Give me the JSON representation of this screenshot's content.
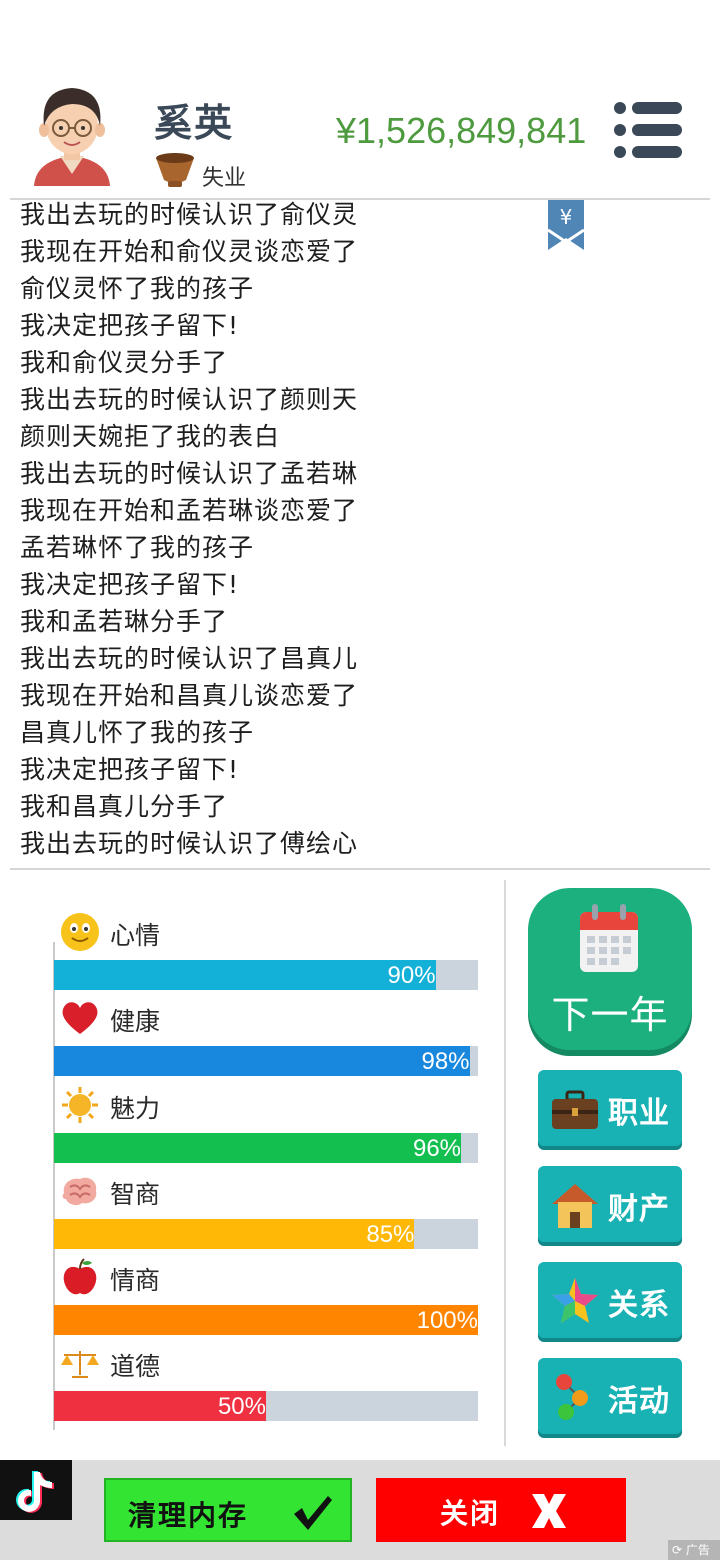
{
  "header": {
    "name": "奚英",
    "job": "失业",
    "money": "¥1,526,849,841"
  },
  "log": [
    "我出去玩的时候认识了俞仪灵",
    "我现在开始和俞仪灵谈恋爱了",
    "俞仪灵怀了我的孩子",
    "我决定把孩子留下!",
    "我和俞仪灵分手了",
    "我出去玩的时候认识了颜则天",
    "颜则天婉拒了我的表白",
    "我出去玩的时候认识了孟若琳",
    "我现在开始和孟若琳谈恋爱了",
    "孟若琳怀了我的孩子",
    "我决定把孩子留下!",
    "我和孟若琳分手了",
    "我出去玩的时候认识了昌真儿",
    "我现在开始和昌真儿谈恋爱了",
    "昌真儿怀了我的孩子",
    "我决定把孩子留下!",
    "我和昌真儿分手了",
    "我出去玩的时候认识了傅绘心"
  ],
  "bookmark_symbol": "¥",
  "stats": [
    {
      "label": "心情",
      "value": 90,
      "display": "90%",
      "color": "#13b0d8",
      "icon": "smiley-icon"
    },
    {
      "label": "健康",
      "value": 98,
      "display": "98%",
      "color": "#1888de",
      "icon": "heart-icon"
    },
    {
      "label": "魅力",
      "value": 96,
      "display": "96%",
      "color": "#12bf4f",
      "icon": "sun-icon"
    },
    {
      "label": "智商",
      "value": 85,
      "display": "85%",
      "color": "#ffb805",
      "icon": "brain-icon"
    },
    {
      "label": "情商",
      "value": 100,
      "display": "100%",
      "color": "#ff8500",
      "icon": "apple-icon"
    },
    {
      "label": "道德",
      "value": 50,
      "display": "50%",
      "color": "#ef3040",
      "icon": "scales-icon"
    }
  ],
  "buttons": {
    "next_year": "下一年",
    "career": "职业",
    "assets": "财产",
    "relations": "关系",
    "activities": "活动"
  },
  "ad": {
    "clear": "清理内存",
    "close": "关闭",
    "tag": "广告"
  }
}
